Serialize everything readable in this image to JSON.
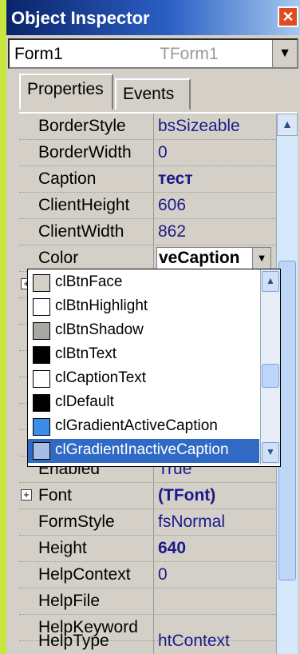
{
  "window": {
    "title": "Object Inspector"
  },
  "object_selector": {
    "name": "Form1",
    "type": "TForm1"
  },
  "tabs": [
    {
      "label": "Properties"
    },
    {
      "label": "Events"
    }
  ],
  "properties": [
    {
      "name": "BorderStyle",
      "value": "bsSizeable"
    },
    {
      "name": "BorderWidth",
      "value": "0"
    },
    {
      "name": "Caption",
      "value": "тест"
    },
    {
      "name": "ClientHeight",
      "value": "606"
    },
    {
      "name": "ClientWidth",
      "value": "862"
    },
    {
      "name": "Color",
      "value": "veCaption"
    },
    {
      "name": "Enabled",
      "value": "True"
    },
    {
      "name": "Font",
      "value": "(TFont)"
    },
    {
      "name": "FormStyle",
      "value": "fsNormal"
    },
    {
      "name": "Height",
      "value": "640"
    },
    {
      "name": "HelpContext",
      "value": "0"
    },
    {
      "name": "HelpFile",
      "value": ""
    },
    {
      "name": "HelpKeyword",
      "value": ""
    },
    {
      "name": "HelpType",
      "value": "htContext"
    }
  ],
  "color_dropdown": {
    "items": [
      {
        "label": "clBtnFace",
        "color": "#d4d0c8"
      },
      {
        "label": "clBtnHighlight",
        "color": "#ffffff"
      },
      {
        "label": "clBtnShadow",
        "color": "#a8a8a0"
      },
      {
        "label": "clBtnText",
        "color": "#000000"
      },
      {
        "label": "clCaptionText",
        "color": "#ffffff"
      },
      {
        "label": "clDefault",
        "color": "#000000"
      },
      {
        "label": "clGradientActiveCaption",
        "color": "#3a8ee8"
      },
      {
        "label": "clGradientInactiveCaption",
        "color": "#a6bde4"
      }
    ],
    "selected": "clGradientInactiveCaption"
  }
}
